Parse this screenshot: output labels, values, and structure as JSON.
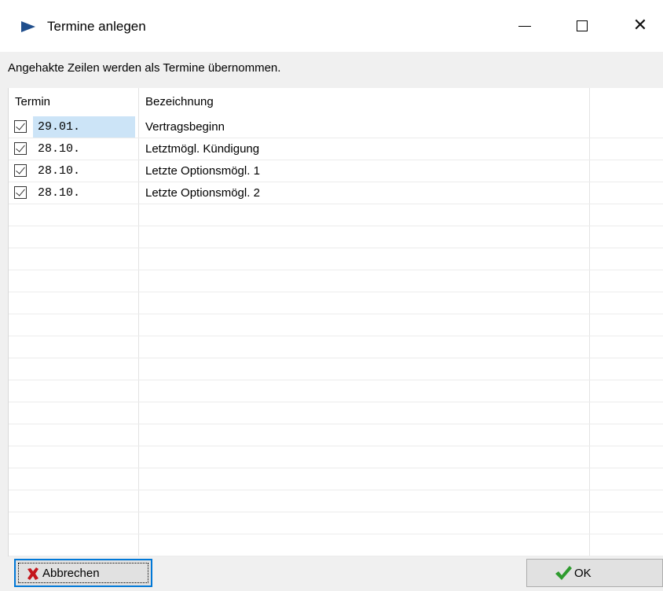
{
  "window": {
    "title": "Termine anlegen",
    "icon": "play-triangle-icon",
    "accent_color": "#1f4e8c"
  },
  "hint": {
    "text": "Angehakte Zeilen werden als Termine übernommen."
  },
  "grid": {
    "columns": [
      "Termin",
      "Bezeichnung",
      ""
    ],
    "rows": [
      {
        "checked": true,
        "termin": "29.01.",
        "bezeichnung": "Vertragsbeginn",
        "selected": true
      },
      {
        "checked": true,
        "termin": "28.10.",
        "bezeichnung": "Letztmögl. Kündigung",
        "selected": false
      },
      {
        "checked": true,
        "termin": "28.10.",
        "bezeichnung": "Letzte Optionsmögl. 1",
        "selected": false
      },
      {
        "checked": true,
        "termin": "28.10.",
        "bezeichnung": "Letzte Optionsmögl. 2",
        "selected": false
      }
    ],
    "selection_color": "#cce4f7"
  },
  "buttons": {
    "cancel_label": "Abbrechen",
    "cancel_icon": "red-x-icon",
    "ok_label": "OK",
    "ok_icon": "green-check-icon"
  }
}
